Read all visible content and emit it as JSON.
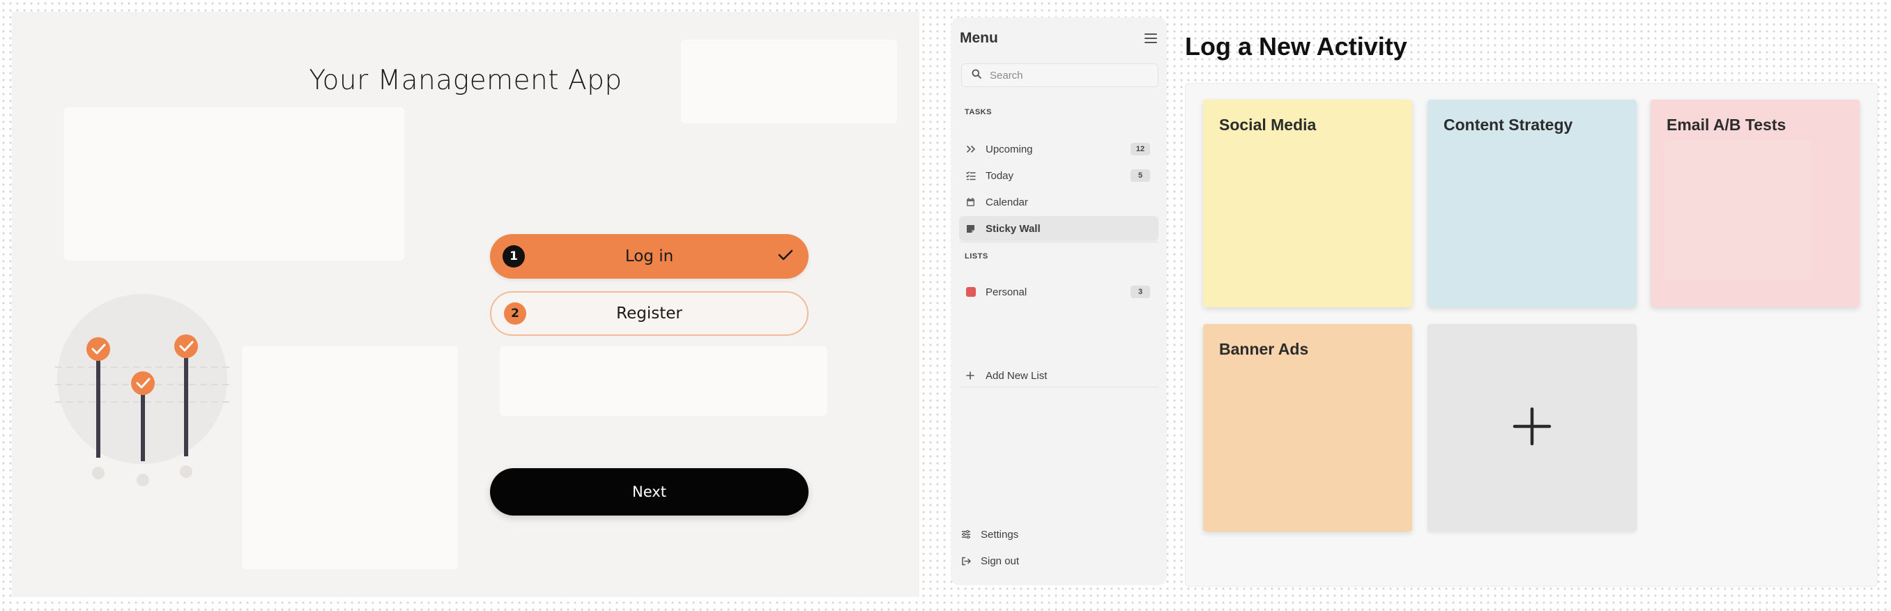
{
  "login_screen": {
    "title": "Your Management App",
    "steps": [
      {
        "number": "1",
        "label": "Log in",
        "state": "active"
      },
      {
        "number": "2",
        "label": "Register",
        "state": "inactive"
      }
    ],
    "next_label": "Next"
  },
  "sidebar": {
    "title": "Menu",
    "search_placeholder": "Search",
    "tasks_section": "TASKS",
    "tasks": [
      {
        "label": "Upcoming",
        "count": "12",
        "icon": "double-chevron-right-icon"
      },
      {
        "label": "Today",
        "count": "5",
        "icon": "checklist-icon"
      },
      {
        "label": "Calendar",
        "count": "",
        "icon": "calendar-icon"
      },
      {
        "label": "Sticky Wall",
        "count": "",
        "icon": "sticky-note-icon"
      }
    ],
    "lists_section": "LISTS",
    "lists": [
      {
        "label": "Personal",
        "count": "3",
        "color": "#e05a5a"
      }
    ],
    "add_list_label": "Add New List",
    "settings_label": "Settings",
    "signout_label": "Sign out"
  },
  "main": {
    "title": "Log a New Activity",
    "notes": [
      {
        "title": "Social Media",
        "color": "#fbf0b8"
      },
      {
        "title": "Content Strategy",
        "color": "#d3e7ec"
      },
      {
        "title": "Email A/B Tests",
        "color": "#f8d8d8"
      },
      {
        "title": "Banner Ads",
        "color": "#f7d4ab"
      }
    ],
    "add_note_icon": "plus-icon"
  },
  "colors": {
    "accent": "#ee8449",
    "dark": "#050505"
  }
}
